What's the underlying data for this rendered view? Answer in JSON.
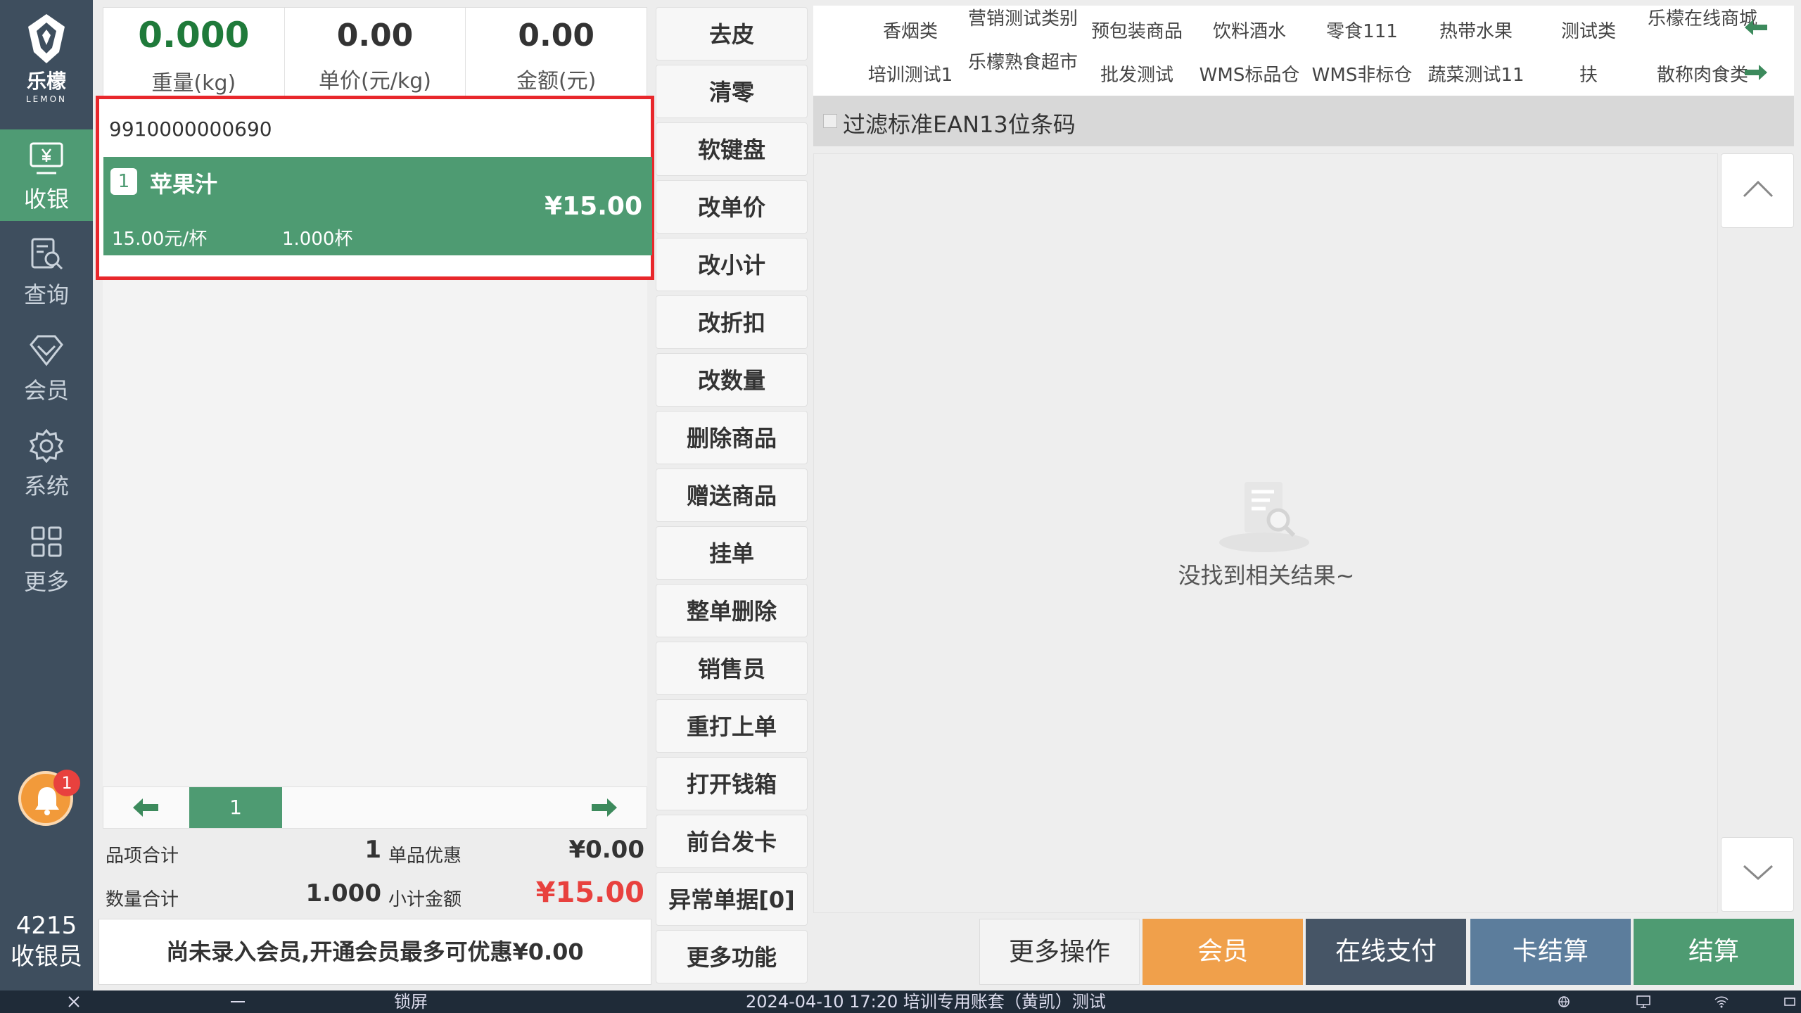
{
  "app": {
    "logo_cn": "乐檬",
    "logo_en": "LEMON"
  },
  "nav": {
    "items": [
      {
        "label": "收银",
        "icon": "cashier-icon",
        "active": true
      },
      {
        "label": "查询",
        "icon": "search-doc-icon"
      },
      {
        "label": "会员",
        "icon": "diamond-icon"
      },
      {
        "label": "系统",
        "icon": "gear-icon"
      },
      {
        "label": "更多",
        "icon": "grid-icon"
      }
    ],
    "notification_count": "1",
    "user_id": "4215",
    "user_role": "收银员"
  },
  "readout": {
    "weight_value": "0.000",
    "weight_label": "重量(kg)",
    "unit_price_value": "0.00",
    "unit_price_label": "单价(元/kg)",
    "amount_value": "0.00",
    "amount_label": "金额(元)"
  },
  "cart": {
    "barcode": "9910000000690",
    "items": [
      {
        "index": "1",
        "name": "苹果汁",
        "amount": "¥15.00",
        "unit_price": "15.00元/杯",
        "quantity": "1.000杯"
      }
    ]
  },
  "pager": {
    "page": "1"
  },
  "summary": {
    "item_count_label": "品项合计",
    "item_count": "1",
    "discount_label": "单品优惠",
    "discount": "¥0.00",
    "qty_label": "数量合计",
    "qty": "1.000",
    "subtotal_label": "小计金额",
    "subtotal": "¥15.00"
  },
  "member_banner": "尚未录入会员,开通会员最多可优惠¥0.00",
  "functions": [
    "去皮",
    "清零",
    "软键盘",
    "改单价",
    "改小计",
    "改折扣",
    "改数量",
    "删除商品",
    "赠送商品",
    "挂单",
    "整单删除",
    "销售员",
    "重打上单",
    "打开钱箱",
    "前台发卡",
    "异常单据[0]",
    "更多功能"
  ],
  "categories": {
    "row1": [
      "香烟类",
      "营销测试类别",
      "预包装商品",
      "饮料酒水",
      "零食111",
      "热带水果",
      "测试类",
      "乐檬在线商城"
    ],
    "row2": [
      "培训测试1",
      "乐檬熟食超市",
      "批发测试",
      "WMS标品仓",
      "WMS非标仓",
      "蔬菜测试11",
      "扶",
      "散称肉食类"
    ]
  },
  "filter": {
    "label": "过滤标准EAN13位条码",
    "checked": false
  },
  "results": {
    "empty_text": "没找到相关结果~"
  },
  "actions": [
    {
      "label": "更多操作",
      "color": "#f3f3f3"
    },
    {
      "label": "会员",
      "color": "#f0a04b"
    },
    {
      "label": "在线支付",
      "color": "#465566"
    },
    {
      "label": "卡结算",
      "color": "#5c7d9c"
    },
    {
      "label": "结算",
      "color": "#4e9b72"
    }
  ],
  "taskbar": {
    "lock": "锁屏",
    "status": "2024-04-10 17:20 培训专用账套（黄凯）测试"
  }
}
